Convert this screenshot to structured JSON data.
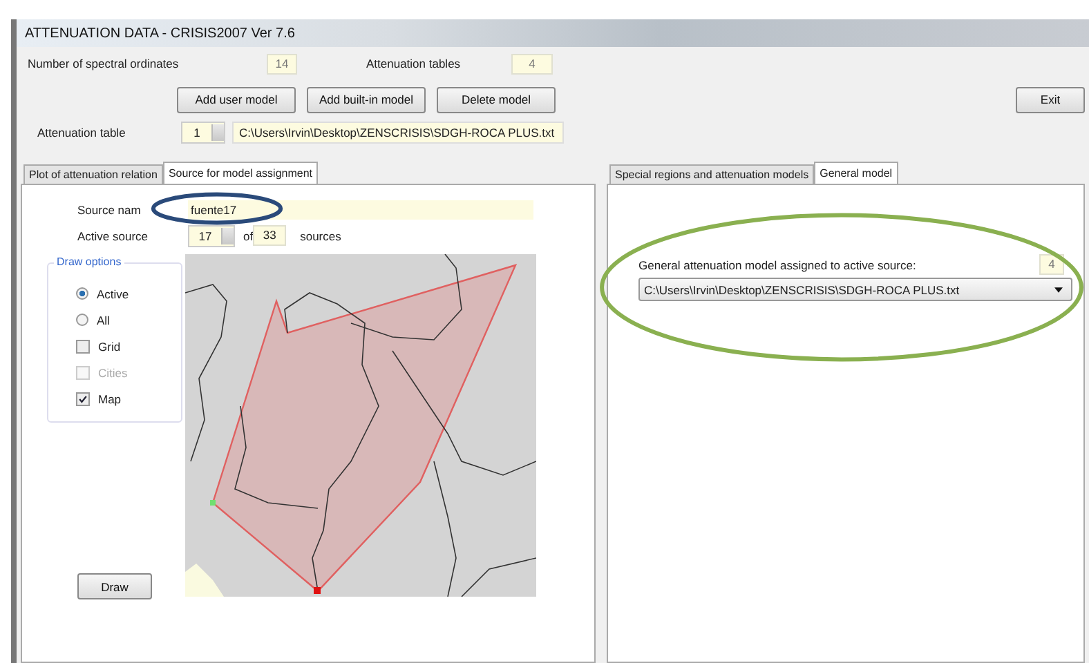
{
  "window": {
    "title": "ATTENUATION DATA - CRISIS2007 Ver 7.6"
  },
  "header": {
    "spectral_label": "Number of spectral ordinates",
    "spectral_value": "14",
    "tables_label": "Attenuation tables",
    "tables_value": "4",
    "buttons": [
      "Add user model",
      "Add built-in model",
      "Delete model"
    ],
    "exit": "Exit",
    "table_label": "Attenuation table",
    "table_index": "1",
    "table_path": "C:\\Users\\Irvin\\Desktop\\ZENSCRISIS\\SDGH-ROCA PLUS.txt"
  },
  "left_tabs": [
    {
      "label": "Plot of attenuation relation",
      "selected": false
    },
    {
      "label": "Source for model assignment",
      "selected": true
    }
  ],
  "source": {
    "name_label": "Source nam",
    "name_value": "fuente17",
    "active_label": "Active source",
    "active_value": "17",
    "of": "of",
    "total": "33",
    "unit": "sources"
  },
  "draw_options": {
    "title": "Draw options",
    "items": [
      {
        "kind": "radio",
        "label": "Active",
        "checked": true,
        "disabled": false
      },
      {
        "kind": "radio",
        "label": "All",
        "checked": false,
        "disabled": false
      },
      {
        "kind": "checkbox",
        "label": "Grid",
        "checked": false,
        "disabled": false
      },
      {
        "kind": "checkbox",
        "label": "Cities",
        "checked": false,
        "disabled": true
      },
      {
        "kind": "checkbox",
        "label": "Map",
        "checked": true,
        "disabled": false
      }
    ]
  },
  "draw_button": "Draw",
  "right_tabs": [
    {
      "label": "Special regions and attenuation models",
      "selected": false
    },
    {
      "label": "General model",
      "selected": true
    }
  ],
  "general": {
    "label": "General attenuation model assigned to active source:",
    "value": "4",
    "selection": "C:\\Users\\Irvin\\Desktop\\ZENSCRISIS\\SDGH-ROCA PLUS.txt"
  }
}
